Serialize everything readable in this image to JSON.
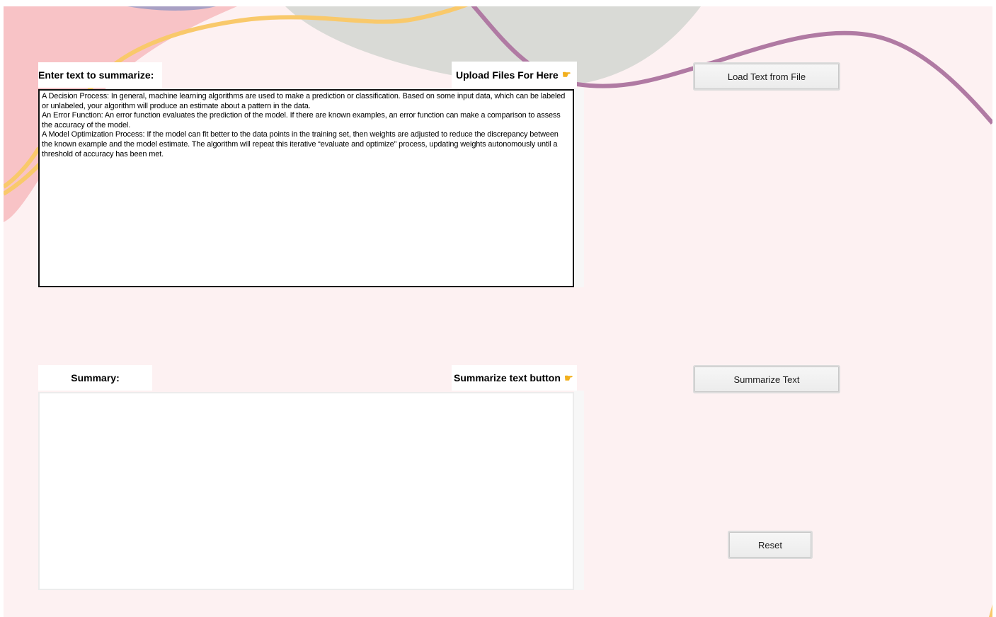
{
  "input_section": {
    "label": "Enter text to summarize:",
    "upload_label": "Upload Files For Here",
    "upload_pointer_icon": "pointing-hand-icon",
    "text_lines": [
      "A Decision Process: In general, machine learning algorithms are used to make a prediction or classification. Based on some input data, which can be labeled or unlabeled, your algorithm will produce an estimate about a pattern in the data.",
      "An Error Function: An error function evaluates the prediction of the model. If there are known examples, an error function can make a comparison to assess the accuracy of the model.",
      "A Model Optimization Process: If the model can fit better to the data points in the training set, then weights are adjusted to reduce the discrepancy between the known example and the model estimate. The algorithm will repeat this iterative “evaluate and optimize” process, updating weights autonomously until a threshold of accuracy has been met."
    ]
  },
  "summary_section": {
    "label": "Summary:",
    "button_hint": "Summarize text button",
    "button_hint_icon": "pointing-hand-icon",
    "output": ""
  },
  "buttons": {
    "load": "Load Text from File",
    "summarize": "Summarize Text",
    "reset": "Reset"
  },
  "colors": {
    "background": "#fdf1f2",
    "accent_yellow": "#f9c96b",
    "accent_purple": "#b07aa3",
    "accent_pink": "#f8c3c6",
    "accent_gray": "#d9dad6"
  }
}
